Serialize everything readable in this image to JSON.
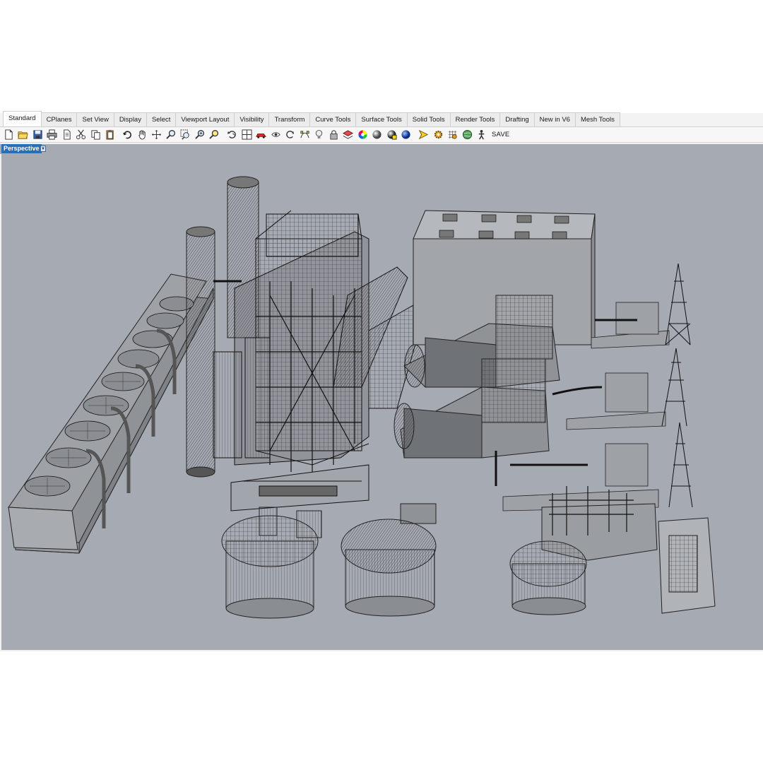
{
  "tabs": [
    {
      "label": "Standard",
      "active": true
    },
    {
      "label": "CPlanes"
    },
    {
      "label": "Set View"
    },
    {
      "label": "Display"
    },
    {
      "label": "Select"
    },
    {
      "label": "Viewport Layout"
    },
    {
      "label": "Visibility"
    },
    {
      "label": "Transform"
    },
    {
      "label": "Curve Tools"
    },
    {
      "label": "Surface Tools"
    },
    {
      "label": "Solid Tools"
    },
    {
      "label": "Render Tools"
    },
    {
      "label": "Drafting"
    },
    {
      "label": "New in V6"
    },
    {
      "label": "Mesh Tools"
    }
  ],
  "toolbar": {
    "icons": [
      "new-file-icon",
      "open-folder-icon",
      "save-icon",
      "print-icon",
      "copy-document-icon",
      "cut-icon",
      "copy-icon",
      "paste-icon",
      "undo-icon",
      "pan-hand-icon",
      "rotate-view-icon",
      "zoom-icon",
      "zoom-window-icon",
      "zoom-extents-icon",
      "zoom-selected-icon",
      "undo-view-icon",
      "four-viewports-icon",
      "car-render-icon",
      "camera-icon",
      "refresh-icon",
      "point-edit-icon",
      "light-bulb-icon",
      "lock-icon",
      "layer-icon",
      "color-wheel-icon",
      "shaded-sphere-icon",
      "rendered-sphere-icon",
      "blue-sphere-icon",
      "sun-icon",
      "options-gear-icon",
      "grid-settings-icon",
      "globe-icon",
      "person-icon"
    ],
    "save_label": "SAVE"
  },
  "viewport": {
    "label": "Perspective",
    "background": "#a6aab3"
  }
}
